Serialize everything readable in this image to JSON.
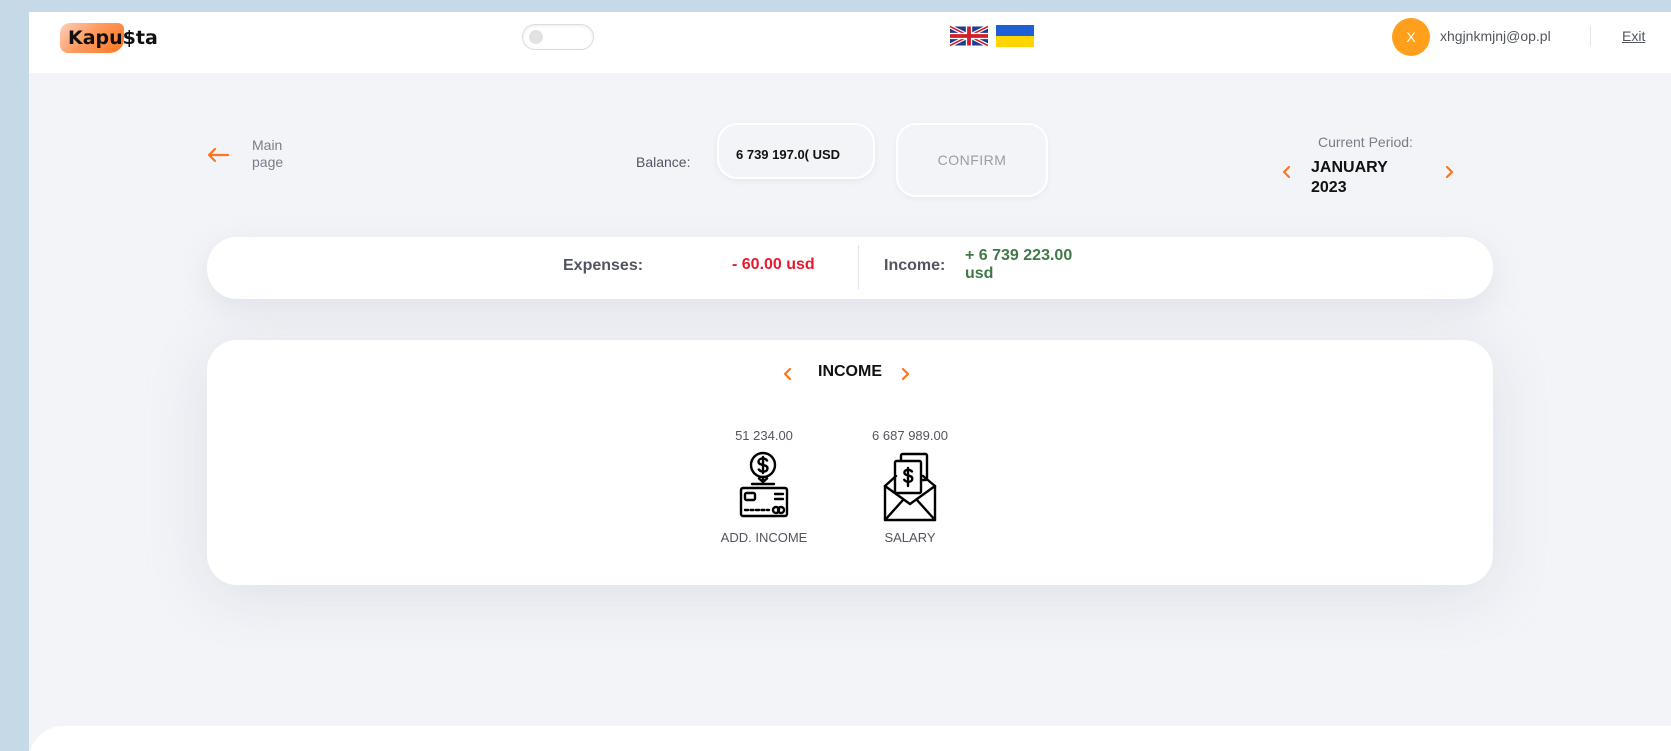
{
  "header": {
    "logo": "Kapu$ta",
    "user_initial": "X",
    "email": "xhgjnkmjnj@op.pl",
    "exit_label": "Exit"
  },
  "topbar": {
    "back_label": "Main page",
    "balance_label": "Balance:",
    "balance_value": "6 739 197.0( USD",
    "confirm_label": "CONFIRM",
    "period_label": "Current Period:",
    "period_value": "JANUARY 2023"
  },
  "summary": {
    "expenses_label": "Expenses:",
    "expenses_value": "- 60.00  usd",
    "income_label": "Income:",
    "income_value": "+ 6 739 223.00 usd"
  },
  "categories": {
    "title": "INCOME",
    "items": [
      {
        "amount": "51 234.00",
        "label": "ADD. INCOME",
        "icon": "add-income-icon"
      },
      {
        "amount": "6 687 989.00",
        "label": "SALARY",
        "icon": "salary-icon"
      }
    ]
  },
  "colors": {
    "accent": "#ff751d",
    "expense": "#e7192e",
    "income": "#407946",
    "avatar": "#ff9f1c"
  }
}
